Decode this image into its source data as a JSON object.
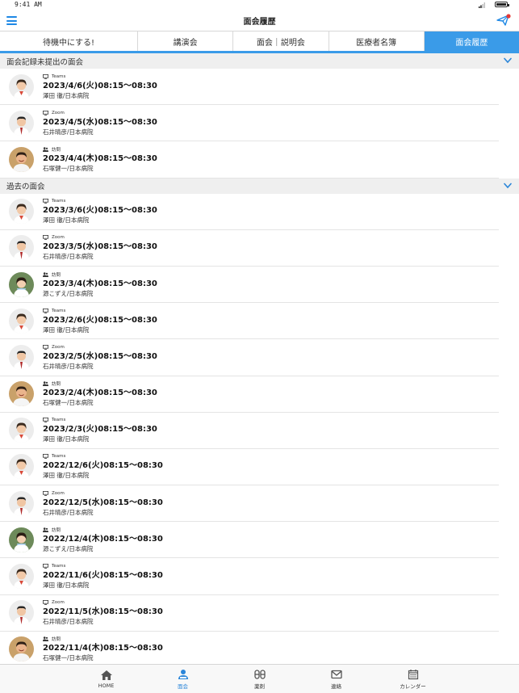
{
  "status": {
    "time": "9:41 AM"
  },
  "header": {
    "title": "面会履歴"
  },
  "tabs": [
    {
      "label": "待機中にする!",
      "active": false
    },
    {
      "label": "講演会",
      "active": false
    },
    {
      "label": "面会｜説明会",
      "active": false
    },
    {
      "label": "医療者名簿",
      "active": false
    },
    {
      "label": "面会履歴",
      "active": true
    }
  ],
  "sections": [
    {
      "title": "面会記録未提出の面会",
      "items": [
        {
          "method": "Teams",
          "method_icon": "monitor-icon",
          "date": "2023/4/6(火)08:15〜08:30",
          "person": "澤田 徹/日本病院",
          "avatar": "doctor-woman"
        },
        {
          "method": "Zoom",
          "method_icon": "monitor-icon",
          "date": "2023/4/5(水)08:15〜08:30",
          "person": "石井晴彦/日本病院",
          "avatar": "doctor-man"
        },
        {
          "method": "訪問",
          "method_icon": "people-icon",
          "date": "2023/4/4(木)08:15〜08:30",
          "person": "石塚健一/日本病院",
          "avatar": "doctor-smile"
        }
      ]
    },
    {
      "title": "過去の面会",
      "items": [
        {
          "method": "Teams",
          "method_icon": "monitor-icon",
          "date": "2023/3/6(火)08:15〜08:30",
          "person": "澤田 徹/日本病院",
          "avatar": "doctor-woman"
        },
        {
          "method": "Zoom",
          "method_icon": "monitor-icon",
          "date": "2023/3/5(水)08:15〜08:30",
          "person": "石井晴彦/日本病院",
          "avatar": "doctor-man"
        },
        {
          "method": "訪問",
          "method_icon": "people-icon",
          "date": "2023/3/4(木)08:15〜08:30",
          "person": "源こずえ/日本病院",
          "avatar": "nurse"
        },
        {
          "method": "Teams",
          "method_icon": "monitor-icon",
          "date": "2023/2/6(火)08:15〜08:30",
          "person": "澤田 徹/日本病院",
          "avatar": "doctor-woman"
        },
        {
          "method": "Zoom",
          "method_icon": "monitor-icon",
          "date": "2023/2/5(水)08:15〜08:30",
          "person": "石井晴彦/日本病院",
          "avatar": "doctor-man"
        },
        {
          "method": "訪問",
          "method_icon": "people-icon",
          "date": "2023/2/4(木)08:15〜08:30",
          "person": "石塚健一/日本病院",
          "avatar": "doctor-smile"
        },
        {
          "method": "Teams",
          "method_icon": "monitor-icon",
          "date": "2023/2/3(火)08:15〜08:30",
          "person": "澤田 徹/日本病院",
          "avatar": "doctor-woman"
        },
        {
          "method": "Teams",
          "method_icon": "monitor-icon",
          "date": "2022/12/6(火)08:15〜08:30",
          "person": "澤田 徹/日本病院",
          "avatar": "doctor-woman"
        },
        {
          "method": "Zoom",
          "method_icon": "monitor-icon",
          "date": "2022/12/5(水)08:15〜08:30",
          "person": "石井晴彦/日本病院",
          "avatar": "doctor-man"
        },
        {
          "method": "訪問",
          "method_icon": "people-icon",
          "date": "2022/12/4(木)08:15〜08:30",
          "person": "源こずえ/日本病院",
          "avatar": "nurse"
        },
        {
          "method": "Teams",
          "method_icon": "monitor-icon",
          "date": "2022/11/6(火)08:15〜08:30",
          "person": "澤田 徹/日本病院",
          "avatar": "doctor-woman"
        },
        {
          "method": "Zoom",
          "method_icon": "monitor-icon",
          "date": "2022/11/5(水)08:15〜08:30",
          "person": "石井晴彦/日本病院",
          "avatar": "doctor-man"
        },
        {
          "method": "訪問",
          "method_icon": "people-icon",
          "date": "2022/11/4(木)08:15〜08:30",
          "person": "石塚健一/日本病院",
          "avatar": "doctor-smile"
        }
      ]
    }
  ],
  "tab_bar": [
    {
      "label": "HOME",
      "icon": "home-icon",
      "active": false
    },
    {
      "label": "面会",
      "icon": "meeting-icon",
      "active": true
    },
    {
      "label": "薬剤",
      "icon": "pills-icon",
      "active": false
    },
    {
      "label": "連絡",
      "icon": "mail-icon",
      "active": false
    },
    {
      "label": "カレンダー",
      "icon": "calendar-icon",
      "active": false
    }
  ],
  "colors": {
    "accent": "#3a9be8",
    "menu": "#1e88e5",
    "badge": "#e53935"
  }
}
